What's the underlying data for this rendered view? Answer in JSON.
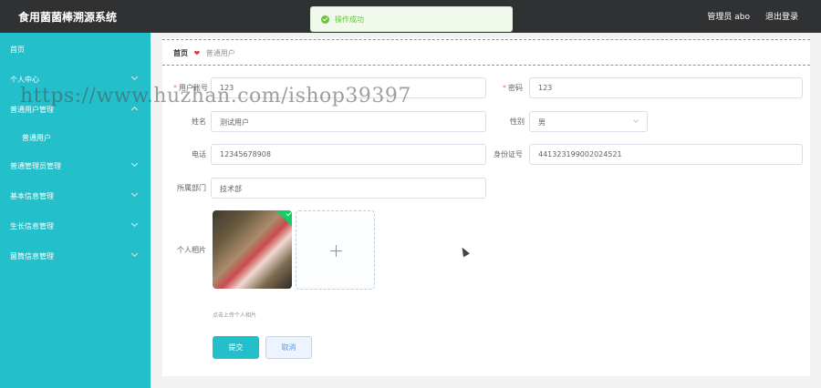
{
  "app": {
    "title": "食用菌菌棒溯源系统"
  },
  "header": {
    "user": "管理员 abo",
    "logout": "退出登录"
  },
  "toast": {
    "message": "操作成功"
  },
  "sidebar": {
    "items": [
      {
        "label": "首页"
      },
      {
        "label": "个人中心"
      },
      {
        "label": "普通用户管理"
      },
      {
        "label": "普通用户"
      },
      {
        "label": "普通管理员管理"
      },
      {
        "label": "基本信息管理"
      },
      {
        "label": "生长信息管理"
      },
      {
        "label": "菌筒信息管理"
      }
    ]
  },
  "breadcrumb": {
    "home": "首页",
    "separator": "❤",
    "current": "普通用户"
  },
  "form": {
    "account_label": "用户账号",
    "account_value": "123",
    "password_label": "密码",
    "password_value": "123",
    "name_label": "姓名",
    "name_value": "测试用户",
    "gender_label": "性别",
    "gender_value": "男",
    "phone_label": "电话",
    "phone_value": "12345678908",
    "idcard_label": "身份证号",
    "idcard_value": "441323199002024521",
    "dept_label": "所属部门",
    "dept_value": "技术部",
    "photo_label": "个人相片",
    "photo_hint": "点击上传个人相片",
    "submit": "提交",
    "cancel": "取消"
  },
  "watermark": {
    "text": "https://www.huzhan.com/ishop39397"
  },
  "colors": {
    "accent": "#23c0cc",
    "topbar": "#303133",
    "success": "#67c23a",
    "required": "#f56c6c"
  }
}
